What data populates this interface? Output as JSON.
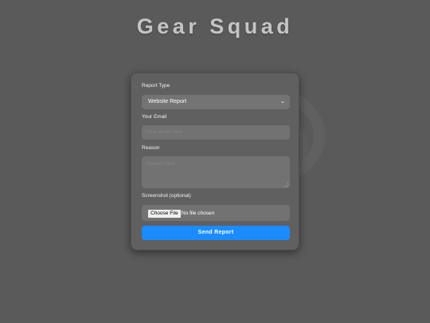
{
  "brand": {
    "title": "Gear Squad",
    "background_icon": "gear-icon"
  },
  "form": {
    "report_type": {
      "label": "Report Type",
      "selected": "Website Report"
    },
    "email": {
      "label": "Your Email",
      "placeholder": "Your email here"
    },
    "reason": {
      "label": "Reason",
      "placeholder": "Explain here"
    },
    "screenshot": {
      "label": "Screenshot (optional)",
      "button_label": "Choose File",
      "status": "No file chosen"
    },
    "submit_label": "Send Report"
  },
  "colors": {
    "page_background": "#5a5a5a",
    "card_background": "#606060",
    "accent": "#1a8cff"
  }
}
